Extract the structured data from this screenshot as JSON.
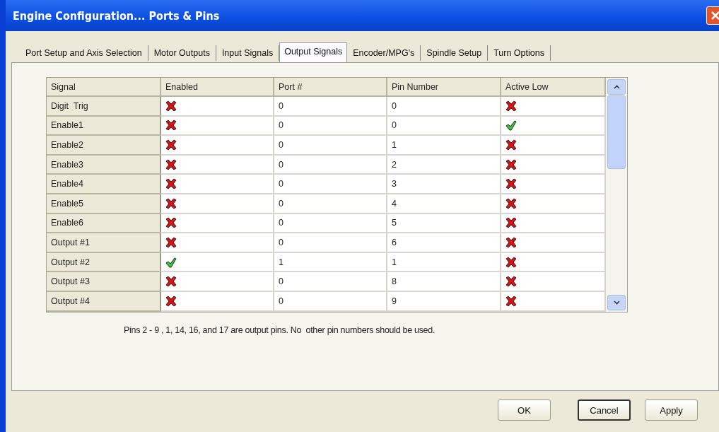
{
  "window": {
    "title": "Engine Configuration... Ports & Pins"
  },
  "tabs": [
    {
      "label": "Port Setup and Axis Selection",
      "selected": false
    },
    {
      "label": "Motor Outputs",
      "selected": false
    },
    {
      "label": "Input Signals",
      "selected": false
    },
    {
      "label": "Output Signals",
      "selected": true
    },
    {
      "label": "Encoder/MPG's",
      "selected": false
    },
    {
      "label": "Spindle Setup",
      "selected": false
    },
    {
      "label": "Turn Options",
      "selected": false
    }
  ],
  "table": {
    "columns": [
      "Signal",
      "Enabled",
      "Port #",
      "Pin Number",
      "Active Low"
    ],
    "rows": [
      {
        "signal": "Digit  Trig",
        "enabled": false,
        "port": "0",
        "pin": "0",
        "active_low": false
      },
      {
        "signal": "Enable1",
        "enabled": false,
        "port": "0",
        "pin": "0",
        "active_low": true
      },
      {
        "signal": "Enable2",
        "enabled": false,
        "port": "0",
        "pin": "1",
        "active_low": false
      },
      {
        "signal": "Enable3",
        "enabled": false,
        "port": "0",
        "pin": "2",
        "active_low": false
      },
      {
        "signal": "Enable4",
        "enabled": false,
        "port": "0",
        "pin": "3",
        "active_low": false
      },
      {
        "signal": "Enable5",
        "enabled": false,
        "port": "0",
        "pin": "4",
        "active_low": false
      },
      {
        "signal": "Enable6",
        "enabled": false,
        "port": "0",
        "pin": "5",
        "active_low": false
      },
      {
        "signal": "Output #1",
        "enabled": false,
        "port": "0",
        "pin": "6",
        "active_low": false
      },
      {
        "signal": "Output #2",
        "enabled": true,
        "port": "1",
        "pin": "1",
        "active_low": false
      },
      {
        "signal": "Output #3",
        "enabled": false,
        "port": "0",
        "pin": "8",
        "active_low": false
      },
      {
        "signal": "Output #4",
        "enabled": false,
        "port": "0",
        "pin": "9",
        "active_low": false
      }
    ]
  },
  "note": "Pins 2 - 9 , 1, 14, 16, and 17 are output pins. No  other pin numbers should be used.",
  "buttons": [
    {
      "label": "OK",
      "default": false
    },
    {
      "label": "Cancel",
      "default": true
    },
    {
      "label": "Apply",
      "default": false
    }
  ]
}
